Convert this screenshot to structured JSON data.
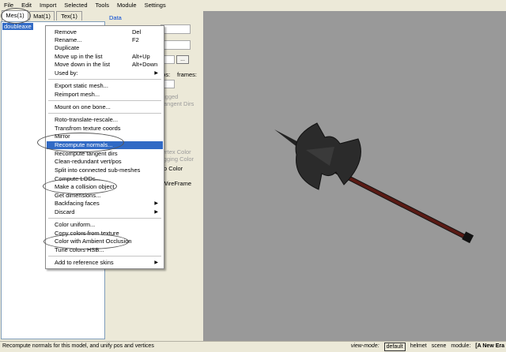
{
  "menubar": [
    "File",
    "Edit",
    "Import",
    "Selected",
    "Tools",
    "Module",
    "Settings"
  ],
  "tabs": [
    "Mes(1)",
    "Mat(1)",
    "Tex(1)"
  ],
  "mesh_list": {
    "items": [
      "doubleaxe"
    ]
  },
  "data_panel": {
    "title": "Data",
    "browse_button": "...",
    "labels": {
      "pos": "pos:",
      "frames": "frames:",
      "rigged": "igged",
      "tangent_dirs": "angent Dirs",
      "vertex_color": "ertex Color",
      "rigging_color": "igging Color",
      "no_color": "o Color",
      "wireframe": "WireFrame"
    }
  },
  "context_menu": {
    "items": [
      {
        "label": "Remove",
        "shortcut": "Del"
      },
      {
        "label": "Rename...",
        "shortcut": "F2"
      },
      {
        "label": "Duplicate"
      },
      {
        "label": "Move up in the list",
        "shortcut": "Alt+Up"
      },
      {
        "label": "Move down in the list",
        "shortcut": "Alt+Down"
      },
      {
        "label": "Used by:",
        "submenu": true
      },
      {
        "label": "Export static mesh..."
      },
      {
        "label": "Reimport mesh..."
      },
      {
        "label": "Mount on one bone..."
      },
      {
        "label": "Roto-translate-rescale..."
      },
      {
        "label": "Transfrom texture coords"
      },
      {
        "label": "Mirror"
      },
      {
        "label": "Recompute normals...",
        "highlighted": true
      },
      {
        "label": "Recompute tangent dirs"
      },
      {
        "label": "Clean-redundant vert/pos"
      },
      {
        "label": "Split into connected sub-meshes"
      },
      {
        "label": "Compute LODs..."
      },
      {
        "label": "Make a collision object"
      },
      {
        "label": "Get dimensions..."
      },
      {
        "label": "Backfacing faces",
        "submenu": true
      },
      {
        "label": "Discard",
        "submenu": true
      },
      {
        "label": "Color uniform..."
      },
      {
        "label": "Copy colors from texture"
      },
      {
        "label": "Color with Ambient Occlusion"
      },
      {
        "label": "Tune colors HSB..."
      },
      {
        "label": "Add to reference skins",
        "submenu": true
      }
    ]
  },
  "statusbar": {
    "message": "Recompute normals for this model, and unify pos and vertices",
    "view_mode_label": "view-mode:",
    "view_mode_value": "default",
    "mode_helmet": "helmet",
    "mode_scene": "scene",
    "module_label": "module:",
    "module_value": "[A New Era"
  },
  "colors": {
    "highlight": "#316ac5",
    "viewport": "#999999",
    "axe_head": "#2b2b2b",
    "axe_shaft": "#5a1a14"
  }
}
